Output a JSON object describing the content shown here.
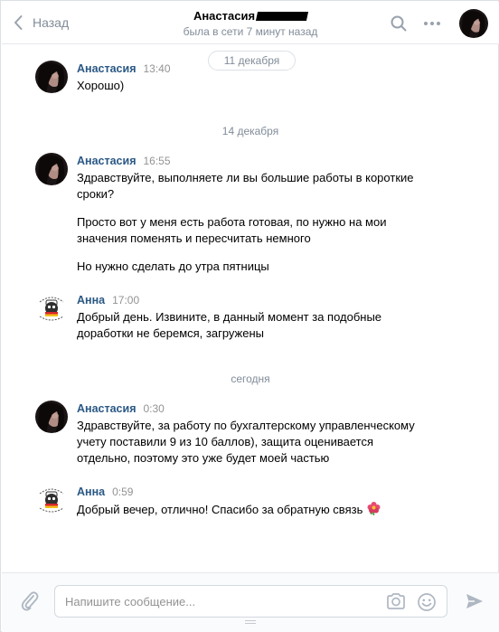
{
  "header": {
    "back_label": "Назад",
    "contact_name": "Анастасия",
    "status": "была в сети 7 минут назад"
  },
  "dates": {
    "d1": "11 декабря",
    "d2": "14 декабря",
    "d3": "сегодня"
  },
  "messages": [
    {
      "author": "Анастасия",
      "time": "13:40",
      "lines": [
        "Хорошо)"
      ]
    },
    {
      "author": "Анастасия",
      "time": "16:55",
      "lines": [
        "Здравствуйте, выполняете ли вы большие работы в короткие",
        "сроки?",
        "Просто вот у меня есть работа готовая, по нужно на мои",
        "значения поменять и пересчитать немного",
        "Но нужно сделать до утра пятницы"
      ]
    },
    {
      "author": "Анна",
      "time": "17:00",
      "lines": [
        "Добрый день. Извините, в данный момент за подобные",
        "доработки не беремся, загружены"
      ]
    },
    {
      "author": "Анастасия",
      "time": "0:30",
      "lines": [
        "Здравствуйте, за работу по бухгалтерскому управленческому",
        "учету поставили 9 из 10 баллов), защита оценивается",
        "отдельно, поэтому это уже будет моей частью"
      ]
    },
    {
      "author": "Анна",
      "time": "0:59",
      "lines": [
        "Добрый вечер, отлично! Спасибо за обратную связь"
      ]
    }
  ],
  "composer": {
    "placeholder": "Напишите сообщение..."
  },
  "icons": {
    "back": "chevron-left-icon",
    "search": "search-icon",
    "more": "more-icon",
    "attach": "paperclip-icon",
    "camera": "camera-icon",
    "emoji": "smile-icon",
    "send": "send-icon",
    "reaction": "flower-emoji"
  },
  "colors": {
    "author": "#2a5885",
    "secondary": "#818c99",
    "icon": "#aeb7c2"
  }
}
